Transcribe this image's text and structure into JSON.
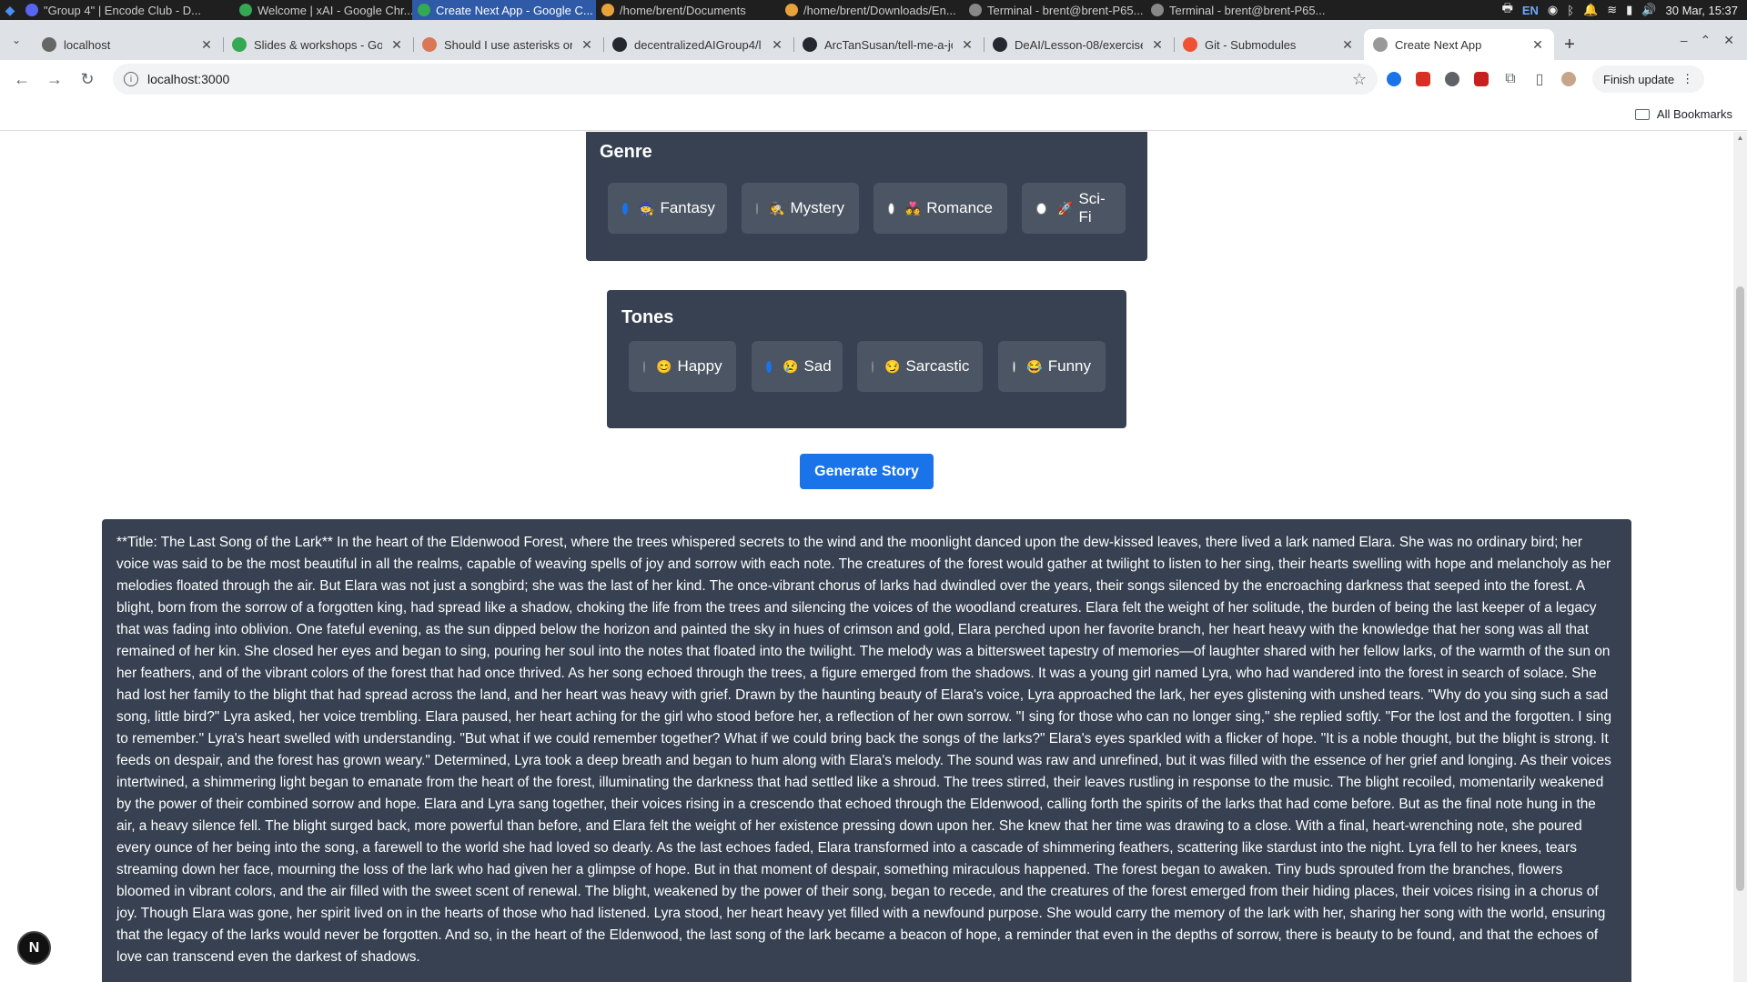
{
  "os_bar": {
    "tasks": [
      {
        "label": "\"Group 4\" | Encode Club - D...",
        "icon_color": "#5865f2",
        "active": false
      },
      {
        "label": "Welcome | xAI - Google Chr...",
        "icon_color": "#34a853",
        "active": false
      },
      {
        "label": "Create Next App - Google C...",
        "icon_color": "#34a853",
        "active": true
      },
      {
        "label": "/home/brent/Documents",
        "icon_color": "#e8a23a",
        "active": false
      },
      {
        "label": "/home/brent/Downloads/En...",
        "icon_color": "#e8a23a",
        "active": false
      },
      {
        "label": "Terminal - brent@brent-P65...",
        "icon_color": "#888888",
        "active": false
      },
      {
        "label": "Terminal - brent@brent-P65...",
        "icon_color": "#888888",
        "active": false
      }
    ],
    "lang": "EN",
    "datetime": "30 Mar, 15:37"
  },
  "tabs": [
    {
      "title": "localhost",
      "favicon": "spinner-icon",
      "color": "#666666",
      "active": false
    },
    {
      "title": "Slides & workshops - Goo",
      "favicon": "drive-icon",
      "color": "#34a853",
      "active": false
    },
    {
      "title": "Should I use asterisks or",
      "favicon": "claude-icon",
      "color": "#d97757",
      "active": false
    },
    {
      "title": "decentralizedAIGroup4/l",
      "favicon": "github-icon",
      "color": "#24292f",
      "active": false
    },
    {
      "title": "ArcTanSusan/tell-me-a-jo",
      "favicon": "github-icon",
      "color": "#24292f",
      "active": false
    },
    {
      "title": "DeAI/Lesson-08/exercise",
      "favicon": "github-icon",
      "color": "#24292f",
      "active": false
    },
    {
      "title": "Git - Submodules",
      "favicon": "git-icon",
      "color": "#f05133",
      "active": false
    },
    {
      "title": "Create Next App",
      "favicon": "vercel-icon",
      "color": "#999999",
      "active": true
    }
  ],
  "toolbar": {
    "url": "localhost:3000",
    "finish_update": "Finish update"
  },
  "bookmarks": {
    "all_bookmarks": "All Bookmarks"
  },
  "genre": {
    "heading": "Genre",
    "options": [
      {
        "label": "Fantasy",
        "emoji": "🧙",
        "checked": true
      },
      {
        "label": "Mystery",
        "emoji": "🕵",
        "checked": false
      },
      {
        "label": "Romance",
        "emoji": "💑",
        "checked": false
      },
      {
        "label": "Sci-Fi",
        "emoji": "🚀",
        "checked": false
      }
    ]
  },
  "tones": {
    "heading": "Tones",
    "options": [
      {
        "label": "Happy",
        "emoji": "😊",
        "checked": false
      },
      {
        "label": "Sad",
        "emoji": "😢",
        "checked": true
      },
      {
        "label": "Sarcastic",
        "emoji": "😏",
        "checked": false
      },
      {
        "label": "Funny",
        "emoji": "😂",
        "checked": false
      }
    ]
  },
  "generate_button": "Generate Story",
  "story": "**Title: The Last Song of the Lark** In the heart of the Eldenwood Forest, where the trees whispered secrets to the wind and the moonlight danced upon the dew-kissed leaves, there lived a lark named Elara. She was no ordinary bird; her voice was said to be the most beautiful in all the realms, capable of weaving spells of joy and sorrow with each note. The creatures of the forest would gather at twilight to listen to her sing, their hearts swelling with hope and melancholy as her melodies floated through the air. But Elara was not just a songbird; she was the last of her kind. The once-vibrant chorus of larks had dwindled over the years, their songs silenced by the encroaching darkness that seeped into the forest. A blight, born from the sorrow of a forgotten king, had spread like a shadow, choking the life from the trees and silencing the voices of the woodland creatures. Elara felt the weight of her solitude, the burden of being the last keeper of a legacy that was fading into oblivion. One fateful evening, as the sun dipped below the horizon and painted the sky in hues of crimson and gold, Elara perched upon her favorite branch, her heart heavy with the knowledge that her song was all that remained of her kin. She closed her eyes and began to sing, pouring her soul into the notes that floated into the twilight. The melody was a bittersweet tapestry of memories—of laughter shared with her fellow larks, of the warmth of the sun on her feathers, and of the vibrant colors of the forest that had once thrived. As her song echoed through the trees, a figure emerged from the shadows. It was a young girl named Lyra, who had wandered into the forest in search of solace. She had lost her family to the blight that had spread across the land, and her heart was heavy with grief. Drawn by the haunting beauty of Elara's voice, Lyra approached the lark, her eyes glistening with unshed tears. \"Why do you sing such a sad song, little bird?\" Lyra asked, her voice trembling. Elara paused, her heart aching for the girl who stood before her, a reflection of her own sorrow. \"I sing for those who can no longer sing,\" she replied softly. \"For the lost and the forgotten. I sing to remember.\" Lyra's heart swelled with understanding. \"But what if we could remember together? What if we could bring back the songs of the larks?\" Elara's eyes sparkled with a flicker of hope. \"It is a noble thought, but the blight is strong. It feeds on despair, and the forest has grown weary.\" Determined, Lyra took a deep breath and began to hum along with Elara's melody. The sound was raw and unrefined, but it was filled with the essence of her grief and longing. As their voices intertwined, a shimmering light began to emanate from the heart of the forest, illuminating the darkness that had settled like a shroud. The trees stirred, their leaves rustling in response to the music. The blight recoiled, momentarily weakened by the power of their combined sorrow and hope. Elara and Lyra sang together, their voices rising in a crescendo that echoed through the Eldenwood, calling forth the spirits of the larks that had come before. But as the final note hung in the air, a heavy silence fell. The blight surged back, more powerful than before, and Elara felt the weight of her existence pressing down upon her. She knew that her time was drawing to a close. With a final, heart-wrenching note, she poured every ounce of her being into the song, a farewell to the world she had loved so dearly. As the last echoes faded, Elara transformed into a cascade of shimmering feathers, scattering like stardust into the night. Lyra fell to her knees, tears streaming down her face, mourning the loss of the lark who had given her a glimpse of hope. But in that moment of despair, something miraculous happened. The forest began to awaken. Tiny buds sprouted from the branches, flowers bloomed in vibrant colors, and the air filled with the sweet scent of renewal. The blight, weakened by the power of their song, began to recede, and the creatures of the forest emerged from their hiding places, their voices rising in a chorus of joy. Though Elara was gone, her spirit lived on in the hearts of those who had listened. Lyra stood, her heart heavy yet filled with a newfound purpose. She would carry the memory of the lark with her, sharing her song with the world, ensuring that the legacy of the larks would never be forgotten. And so, in the heart of the Eldenwood, the last song of the lark became a beacon of hope, a reminder that even in the depths of sorrow, there is beauty to be found, and that the echoes of love can transcend even the darkest of shadows.",
  "next_badge": "N",
  "colors": {
    "panel_bg": "#374151",
    "option_bg": "#4b5563",
    "accent": "#1a73e8"
  }
}
